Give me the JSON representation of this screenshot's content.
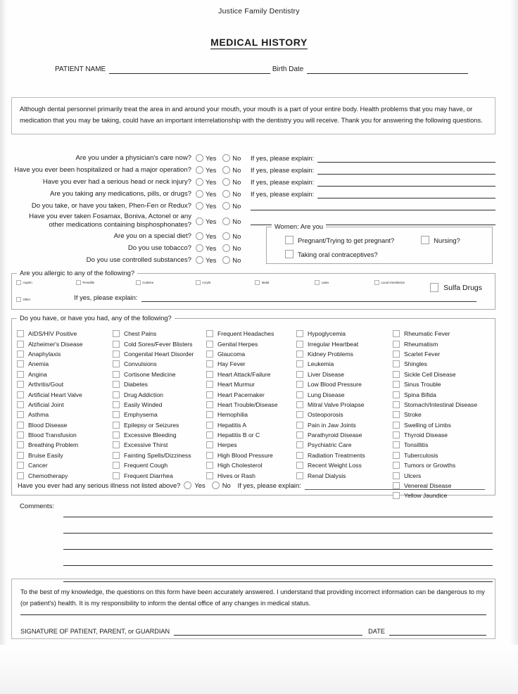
{
  "header": {
    "clinic_name": "Justice Family Dentistry",
    "form_title": "MEDICAL HISTORY",
    "patient_name_label": "PATIENT NAME",
    "birth_date_label": "Birth Date"
  },
  "intro": {
    "text": "Although dental personnel primarily treat the area in and around your mouth, your mouth is a part of your entire body.  Health problems that you may have, or medication that you may be taking, could have an important interrelationship with the dentistry you will receive.  Thank you for answering the following questions."
  },
  "common": {
    "yes_label": "Yes",
    "no_label": "No",
    "explain_label": "If yes, please explain:"
  },
  "questions": [
    {
      "text": "Are you under a physician's care now?",
      "has_explain": true
    },
    {
      "text": "Have you ever been hospitalized or had a major operation?",
      "has_explain": true
    },
    {
      "text": "Have you ever had a serious head or neck injury?",
      "has_explain": true
    },
    {
      "text": "Are you taking any medications, pills, or drugs?",
      "has_explain": true
    },
    {
      "text": "Do you take, or have you taken, Phen-Fen or Redux?",
      "has_explain": false,
      "blank_line": true
    },
    {
      "text_line1": "Have you ever taken Fosamax, Boniva, Actonel or any",
      "text_line2": "other medications containing bisphosphonates?",
      "has_explain": false,
      "blank_line": true
    },
    {
      "text": "Are you on a special diet?",
      "has_explain": false
    },
    {
      "text": "Do you use tobacco?",
      "has_explain": false
    },
    {
      "text": "Do you use controlled substances?",
      "has_explain": false
    }
  ],
  "women": {
    "legend": "Women:  Are you",
    "pregnant_label": "Pregnant/Trying to get pregnant?",
    "nursing_label": "Nursing?",
    "contraceptives_label": "Taking oral contraceptives?"
  },
  "allergies": {
    "legend": "Are you allergic to any of the following?",
    "items": [
      "Aspirin",
      "Penicillin",
      "Codeine",
      "Acrylic",
      "Metal",
      "Latex",
      "Local Anesthetics"
    ],
    "sulfa_label": "Sulfa Drugs",
    "other_label": "Other",
    "explain_label": "If yes, please explain:"
  },
  "conditions": {
    "legend": "Do you have, or have you had, any of the following?",
    "columns": [
      [
        "AIDS/HIV Positive",
        "Alzheimer's Disease",
        "Anaphylaxis",
        "Anemia",
        "Angina",
        "Arthritis/Gout",
        "Artificial Heart Valve",
        "Artificial Joint",
        "Asthma",
        "Blood Disease",
        "Blood Transfusion",
        "Breathing Problem",
        "Bruise Easily",
        "Cancer",
        "Chemotherapy"
      ],
      [
        "Chest Pains",
        "Cold Sores/Fever Blisters",
        "Congenital Heart Disorder",
        "Convulsions",
        "Cortisone Medicine",
        "Diabetes",
        "Drug Addiction",
        "Easily Winded",
        "Emphysema",
        "Epilepsy or Seizures",
        "Excessive Bleeding",
        "Excessive Thirst",
        "Fainting Spells/Dizziness",
        "Frequent Cough",
        "Frequent Diarrhea"
      ],
      [
        "Frequent Headaches",
        "Genital Herpes",
        "Glaucoma",
        "Hay Fever",
        "Heart Attack/Failure",
        "Heart Murmur",
        "Heart Pacemaker",
        "Heart Trouble/Disease",
        "Hemophilia",
        "Hepatitis A",
        "Hepatitis B or C",
        "Herpes",
        "High Blood Pressure",
        "High Cholesterol",
        "Hives or Rash"
      ],
      [
        "Hypoglycemia",
        "Irregular Heartbeat",
        "Kidney Problems",
        "Leukemia",
        "Liver Disease",
        "Low Blood Pressure",
        "Lung Disease",
        "Mitral Valve Prolapse",
        "Osteoporosis",
        "Pain in Jaw Joints",
        "Parathyroid Disease",
        "Psychiatric Care",
        "Radiation Treatments",
        "Recent Weight Loss",
        "Renal Dialysis"
      ],
      [
        "Rheumatic Fever",
        "Rheumatism",
        "Scarlet Fever",
        "Shingles",
        "Sickle Cell Disease",
        "Sinus Trouble",
        "Spina Bifida",
        "Stomach/Intestinal Disease",
        "Stroke",
        "Swelling of Limbs",
        "Thyroid Disease",
        "Tonsillitis",
        "Tuberculosis",
        "Tumors or Growths",
        "Ulcers",
        "Venereal Disease",
        "Yellow Jaundice"
      ]
    ],
    "serious_illness_question": "Have you ever had any serious illness not listed above?",
    "serious_illness_explain": "If yes, please explain:"
  },
  "comments": {
    "label": "Comments:",
    "line_count": 5
  },
  "attestation": {
    "text": "To the best of my knowledge, the questions on this form have been accurately answered.  I understand that providing incorrect information can be dangerous to my (or patient's) health.  It is my responsibility to inform the dental office of any changes in medical status.",
    "signature_label": "SIGNATURE OF PATIENT, PARENT, or GUARDIAN",
    "date_label": "DATE"
  }
}
